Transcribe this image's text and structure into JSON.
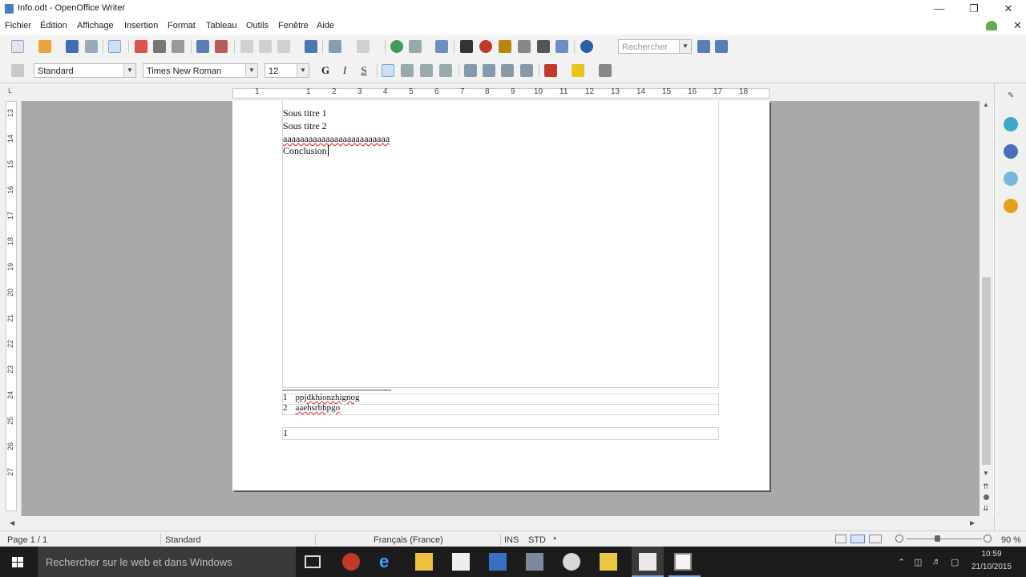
{
  "window": {
    "title": "Info.odt - OpenOffice Writer"
  },
  "menu": [
    "Fichier",
    "Édition",
    "Affichage",
    "Insertion",
    "Format",
    "Tableau",
    "Outils",
    "Fenêtre",
    "Aide"
  ],
  "toolbar1": {
    "search_placeholder": "Rechercher"
  },
  "toolbar2": {
    "paragraph_style": "Standard",
    "font_name": "Times New Roman",
    "font_size": "12",
    "bold_label": "G",
    "italic_label": "I",
    "underline_label": "S"
  },
  "ruler_h": [
    "1",
    "1",
    "2",
    "3",
    "4",
    "5",
    "6",
    "7",
    "8",
    "9",
    "10",
    "11",
    "12",
    "13",
    "14",
    "15",
    "16",
    "17",
    "18"
  ],
  "ruler_v": [
    "13",
    "14",
    "15",
    "16",
    "17",
    "18",
    "19",
    "20",
    "21",
    "22",
    "23",
    "24",
    "25",
    "26",
    "27"
  ],
  "document": {
    "lines": [
      "Sous titre 1",
      "Sous titre 2",
      "aaaaaaaaaaaaaaaaaaaaaaaaa",
      "Conclusion"
    ],
    "footnotes": [
      {
        "num": "1",
        "text": "ppjdkhionzhignog"
      },
      {
        "num": "2",
        "text": "aaehsrbhpgo"
      }
    ],
    "footer_text": "1"
  },
  "statusbar": {
    "page": "Page 1 / 1",
    "style": "Standard",
    "language": "Français (France)",
    "ins": "INS",
    "std": "STD",
    "zoom": "90 %"
  },
  "taskbar": {
    "search_placeholder": "Rechercher sur le web et dans Windows",
    "time": "10:59",
    "date": "21/10/2015"
  }
}
